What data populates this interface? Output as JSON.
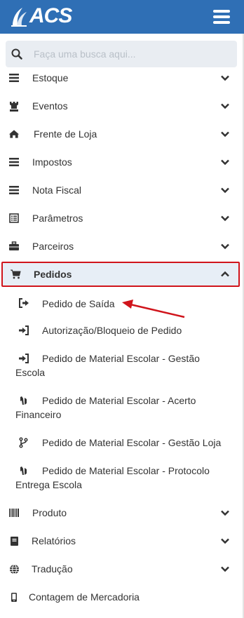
{
  "header": {
    "brand": "ACS"
  },
  "search": {
    "placeholder": "Faça uma busca aqui..."
  },
  "menu": [
    {
      "label": "Estoque",
      "icon": "list-icon"
    },
    {
      "label": "Eventos",
      "icon": "chess-rook-icon"
    },
    {
      "label": "Frente de Loja",
      "icon": "home-icon"
    },
    {
      "label": "Impostos",
      "icon": "list-icon"
    },
    {
      "label": "Nota Fiscal",
      "icon": "list-icon"
    },
    {
      "label": "Parâmetros",
      "icon": "list-alt-icon"
    },
    {
      "label": "Parceiros",
      "icon": "briefcase-icon"
    },
    {
      "label": "Pedidos",
      "icon": "cart-icon",
      "expanded": true
    }
  ],
  "pedidos_sub": [
    {
      "label": "Pedido de Saída",
      "icon": "sign-out-icon"
    },
    {
      "label": "Autorização/Bloqueio de Pedido",
      "icon": "sign-in-icon"
    },
    {
      "label": "Pedido de Material Escolar - Gestão Escola",
      "icon": "sign-in-icon"
    },
    {
      "label": "Pedido de Material Escolar - Acerto Financeiro",
      "icon": "handshake-icon"
    },
    {
      "label": "Pedido de Material Escolar - Gestão Loja",
      "icon": "code-fork-icon"
    },
    {
      "label": "Pedido de Material Escolar - Protocolo Entrega Escola",
      "icon": "handshake-icon"
    }
  ],
  "menu_bottom": [
    {
      "label": "Produto",
      "icon": "barcode-icon"
    },
    {
      "label": "Relatórios",
      "icon": "book-icon"
    },
    {
      "label": "Tradução",
      "icon": "globe-icon"
    },
    {
      "label": "Contagem de Mercadoria",
      "icon": "mobile-icon"
    }
  ],
  "colors": {
    "header": "#2f6fb5",
    "highlight_border": "#d0141b",
    "active_bg": "#e7eef6"
  }
}
